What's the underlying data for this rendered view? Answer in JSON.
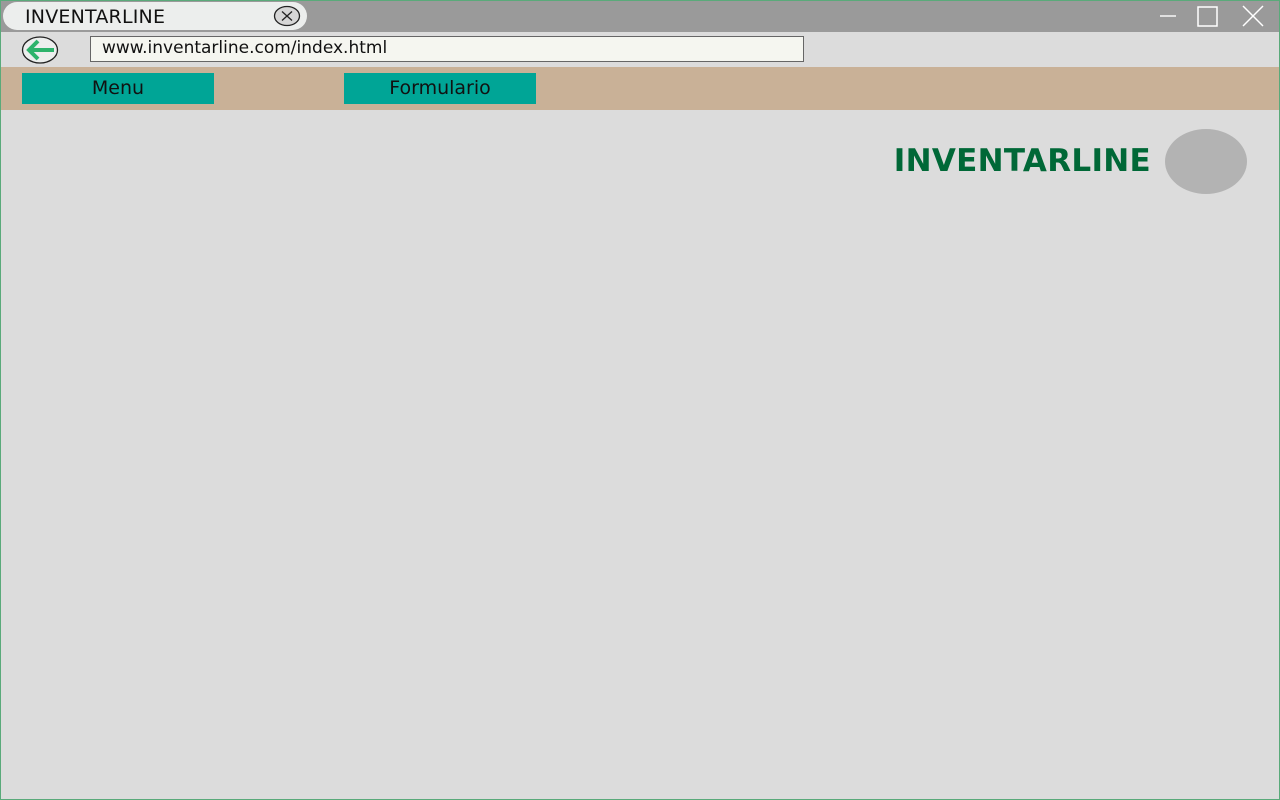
{
  "browser": {
    "tab_title": "INVENTARLINE",
    "url": "www.inventarline.com/index.html",
    "icons": {
      "tab_close": "close-circle-icon",
      "back": "back-arrow-icon",
      "minimize": "minimize-icon",
      "maximize": "maximize-icon",
      "close": "close-icon"
    }
  },
  "nav": {
    "items": [
      {
        "label": "Menu"
      },
      {
        "label": "Formulario"
      }
    ]
  },
  "header": {
    "brand": "INVENTARLINE"
  },
  "colors": {
    "accent": "#00a596",
    "brand": "#006837",
    "navbar": "#c9b197",
    "background": "#dcdcdc"
  }
}
